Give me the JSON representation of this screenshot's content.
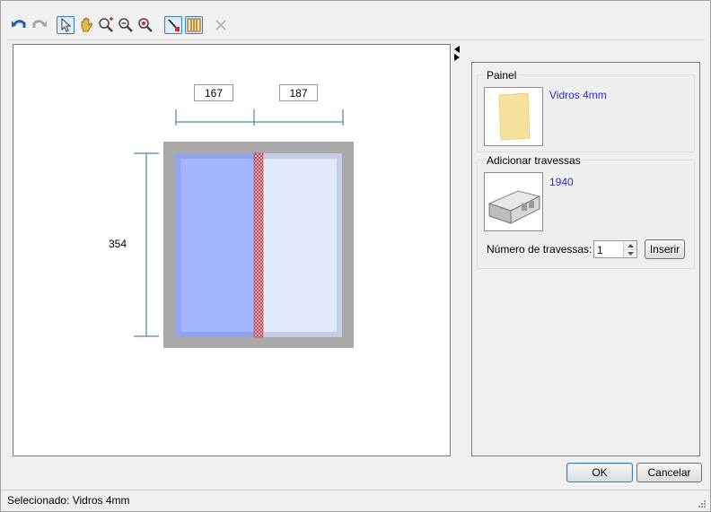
{
  "canvas": {
    "dim_top_left": "167",
    "dim_top_right": "187",
    "dim_height": "354"
  },
  "panel_group": {
    "title": "Painel",
    "item_label": "Vidros 4mm"
  },
  "crossbar_group": {
    "title": "Adicionar travessas",
    "item_label": "1940",
    "count_label": "Número de travessas:",
    "count_value": "1",
    "insert_label": "Inserir"
  },
  "buttons": {
    "ok": "OK",
    "cancel": "Cancelar"
  },
  "status": {
    "text": "Selecionado: Vidros 4mm"
  },
  "icons": [
    "undo-icon",
    "redo-icon",
    "pointer-icon",
    "pan-hand-icon",
    "zoom-in-icon",
    "zoom-out-icon",
    "zoom-fit-icon",
    "crossbar-tool-icon",
    "panel-tool-icon",
    "delete-icon"
  ],
  "colors": {
    "pane_left": "#9fb3fb",
    "pane_right": "#e0e8fb",
    "frame": "#a8a8a8",
    "crossbar": "#d03030",
    "dimension_line": "#2b6d8c",
    "link_text": "#2b2bd6"
  }
}
